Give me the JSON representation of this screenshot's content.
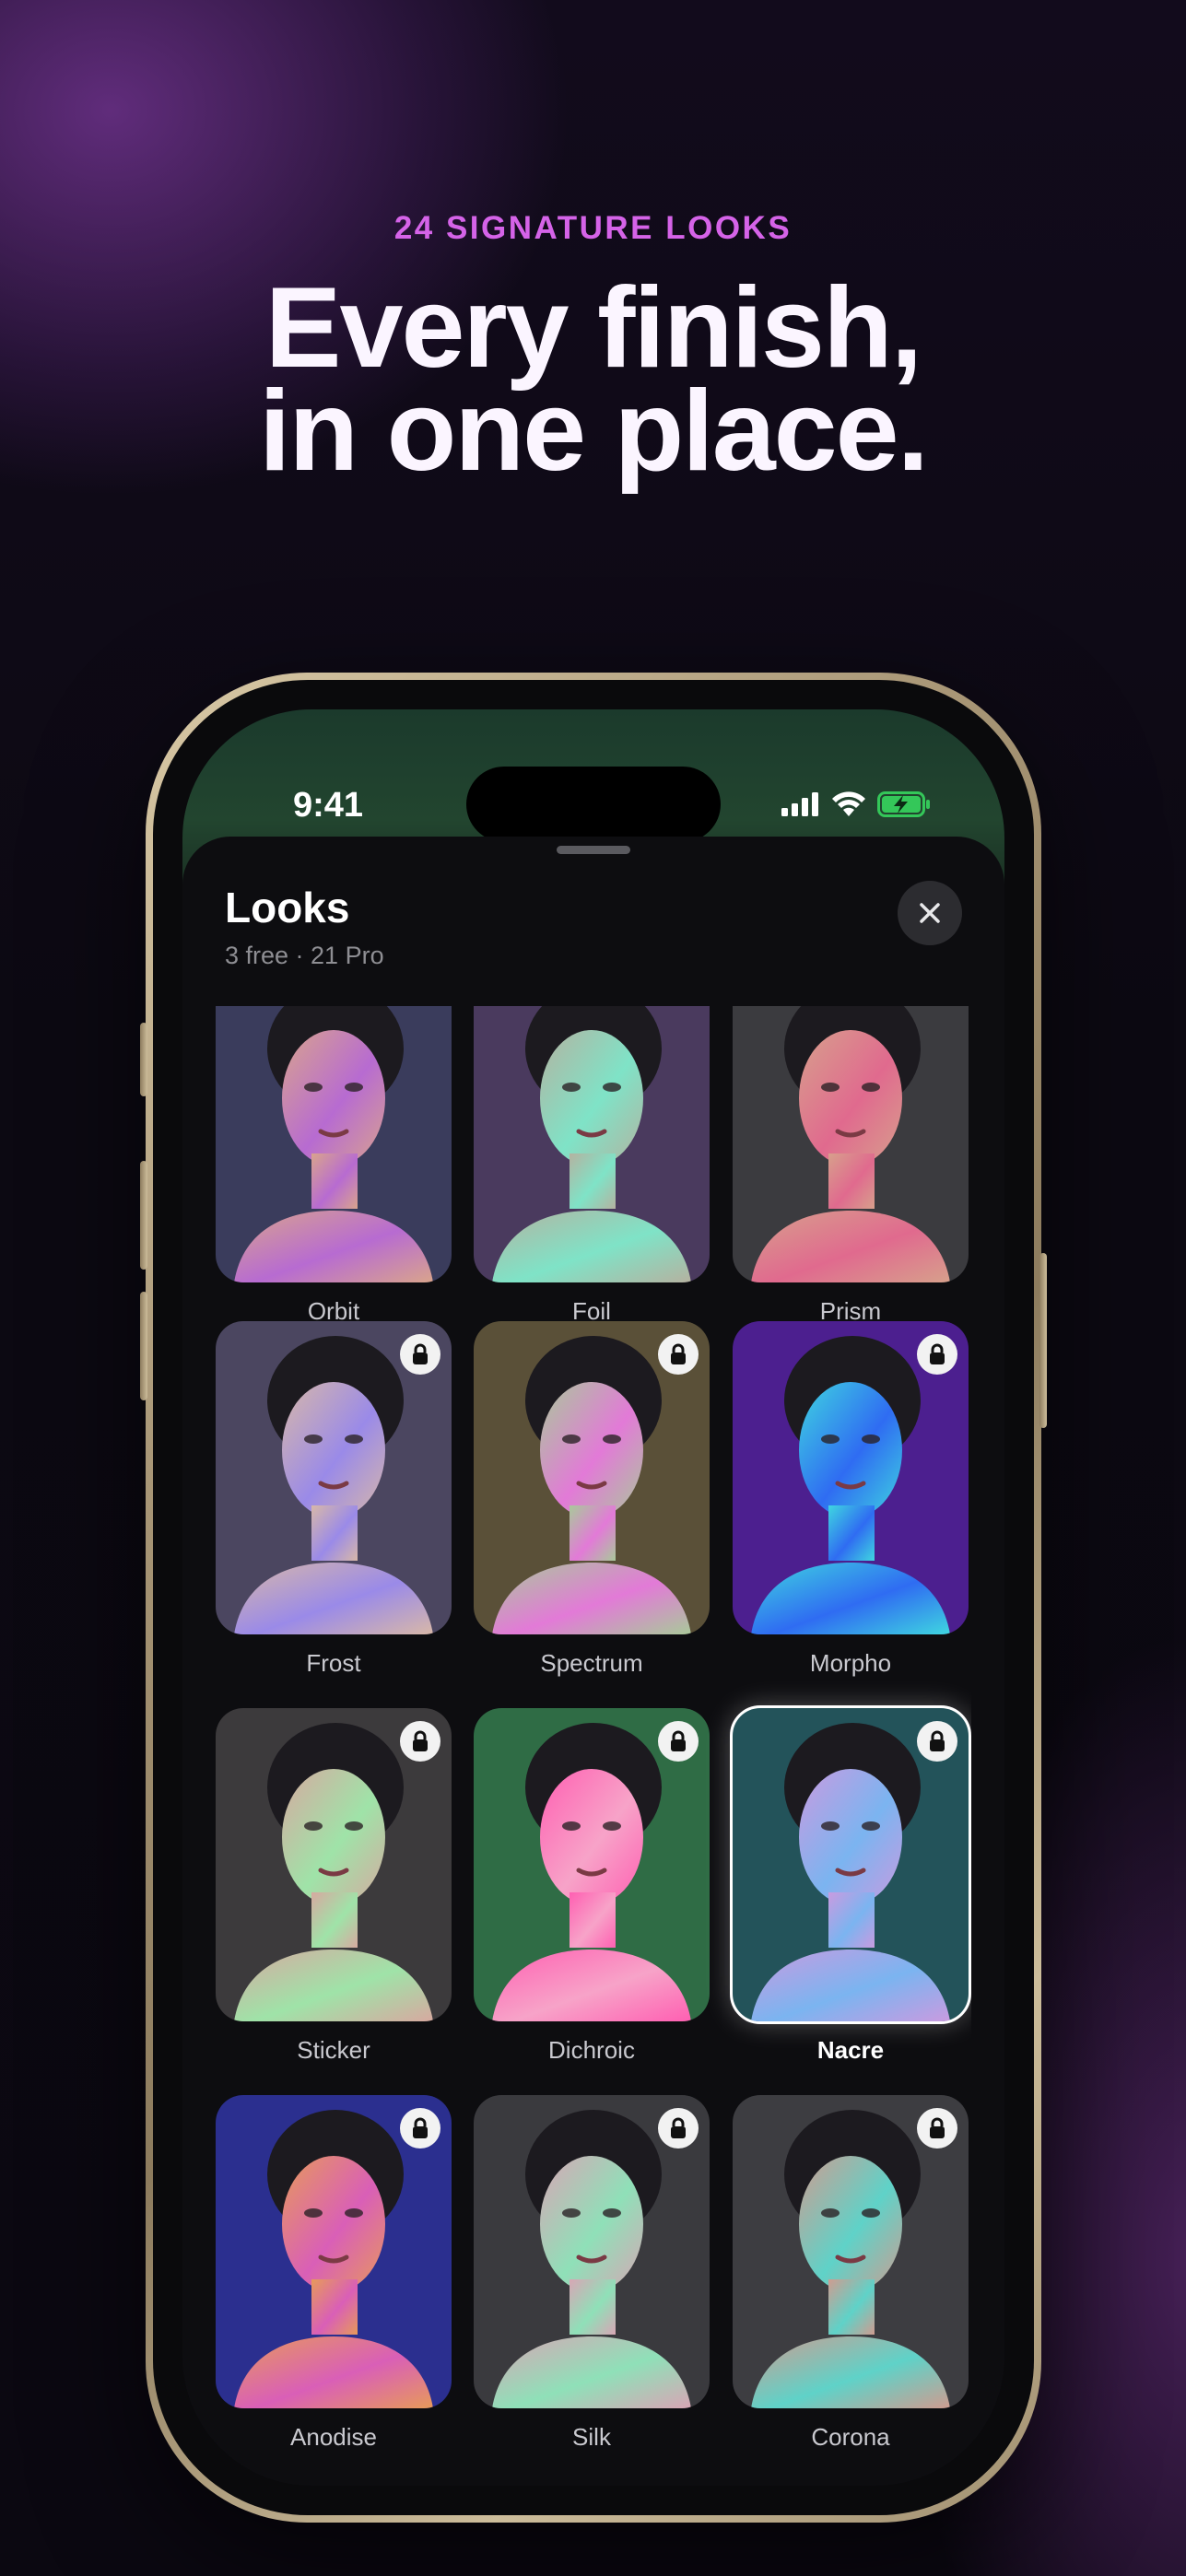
{
  "promo": {
    "eyebrow": "24 SIGNATURE LOOKS",
    "headline_line1": "Every finish,",
    "headline_line2": "in one place."
  },
  "status_bar": {
    "time": "9:41"
  },
  "sheet": {
    "title": "Looks",
    "subtitle": "3 free · 21 Pro"
  },
  "looks": [
    {
      "name": "Orbit",
      "locked": false,
      "selected": false,
      "bg": "#3a3c5c",
      "skin": "#d9a48c",
      "accent": "#b76bd1"
    },
    {
      "name": "Foil",
      "locked": false,
      "selected": false,
      "bg": "#4a3a5e",
      "skin": "#b5b2a0",
      "accent": "#7fe3c7"
    },
    {
      "name": "Prism",
      "locked": false,
      "selected": false,
      "bg": "#3b3b3f",
      "skin": "#d7a08c",
      "accent": "#e06a8e"
    },
    {
      "name": "Frost",
      "locked": true,
      "selected": false,
      "bg": "#4b4660",
      "skin": "#d8b8a8",
      "accent": "#9a8ae8"
    },
    {
      "name": "Spectrum",
      "locked": true,
      "selected": false,
      "bg": "#5a5038",
      "skin": "#a9c99a",
      "accent": "#e27ad7"
    },
    {
      "name": "Morpho",
      "locked": true,
      "selected": false,
      "bg": "#4c1f8f",
      "skin": "#3fd6e0",
      "accent": "#2f6cf2"
    },
    {
      "name": "Sticker",
      "locked": true,
      "selected": false,
      "bg": "#3c3a3c",
      "skin": "#d7a9a0",
      "accent": "#9fe3a8"
    },
    {
      "name": "Dichroic",
      "locked": true,
      "selected": false,
      "bg": "#2f6c45",
      "skin": "#ff5fb2",
      "accent": "#f7a3c8"
    },
    {
      "name": "Nacre",
      "locked": true,
      "selected": true,
      "bg": "#23535a",
      "skin": "#c99be0",
      "accent": "#7bb4f0"
    },
    {
      "name": "Anodise",
      "locked": true,
      "selected": false,
      "bg": "#2b2f8f",
      "skin": "#e79a5a",
      "accent": "#d95fb7"
    },
    {
      "name": "Silk",
      "locked": true,
      "selected": false,
      "bg": "#3a3a3e",
      "skin": "#d8a6b5",
      "accent": "#8fe0b8"
    },
    {
      "name": "Corona",
      "locked": true,
      "selected": false,
      "bg": "#3d3d41",
      "skin": "#cf9c90",
      "accent": "#5fd2c8"
    }
  ],
  "colors": {
    "eyebrow": "#d563e8",
    "headline": "#fbf5ff",
    "sheet_bg": "#0d0d10",
    "phone_frame": "#bba987"
  },
  "icons": {
    "close": "close-icon",
    "lock": "lock-icon",
    "signal": "cellular-signal-icon",
    "wifi": "wifi-icon",
    "battery": "battery-charging-icon"
  }
}
